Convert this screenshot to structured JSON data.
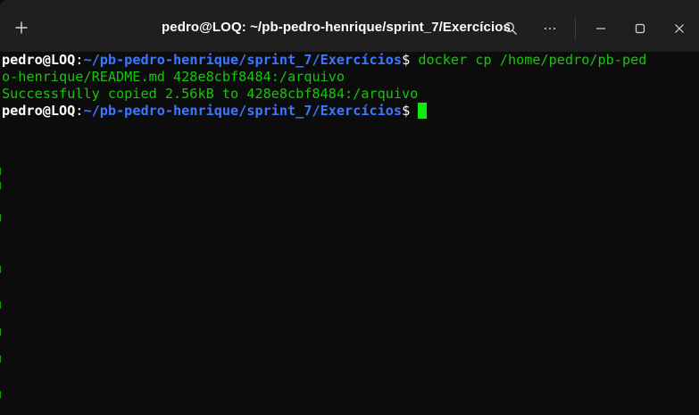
{
  "window": {
    "title": "pedro@LOQ: ~/pb-pedro-henrique/sprint_7/Exercícios",
    "new_tab_icon": "plus-icon",
    "controls": [
      "search-icon",
      "more-icon",
      "minimize-icon",
      "maximize-icon",
      "close-icon"
    ]
  },
  "terminal": {
    "prompt_user": "pedro@LOQ",
    "prompt_colon": ":",
    "prompt_path": "~/pb-pedro-henrique/sprint_7/Exercícios",
    "prompt_symbol": "$ ",
    "command_part1": "docker cp /home/pedro/pb-ped",
    "command_part2": "o-henrique/README.md 428e8cbf8484:/arquivo",
    "output_line": "Successfully copied 2.56kB to 428e8cbf8484:/arquivo",
    "prompt2_user": "pedro@LOQ",
    "prompt2_colon": ":",
    "prompt2_path": "~/pb-pedro-henrique/sprint_7/Exercícios",
    "prompt2_symbol": "$ "
  },
  "colors": {
    "background": "#0c0c0c",
    "titlebar": "#1f1f1f",
    "user": "#ffffff",
    "path": "#3b78ff",
    "command": "#16c60c",
    "cursor": "#13e80d"
  }
}
